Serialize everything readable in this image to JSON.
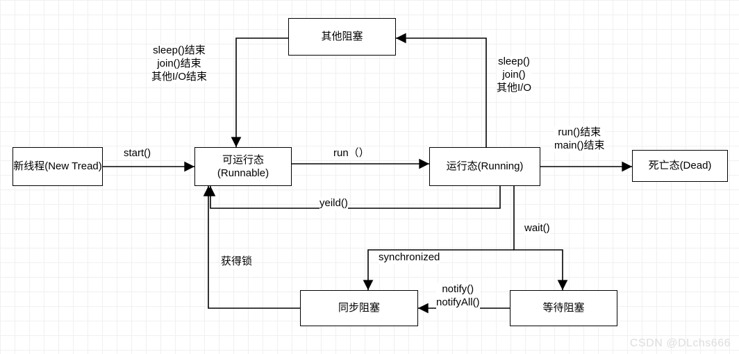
{
  "nodes": {
    "new_thread": "新线程(New Tread)",
    "runnable": "可运行态<br>(Runnable)",
    "running": "运行态(Running)",
    "dead": "死亡态(Dead)",
    "other_block": "其他阻塞",
    "sync_block": "同步阻塞",
    "wait_block": "等待阻塞"
  },
  "edges": {
    "start": "start()",
    "run": "run（）",
    "yield": "yeild()",
    "to_other": "sleep()<br>join()<br>其他I/O",
    "from_other": "sleep()结束<br>join()结束<br>其他I/O结束",
    "run_end": "run()结束<br>main()结束",
    "wait": "wait()",
    "synchronized": "synchronized",
    "notify": "notify()<br>notifyAll()",
    "get_lock": "获得锁"
  },
  "watermark": "CSDN @DLchs666"
}
